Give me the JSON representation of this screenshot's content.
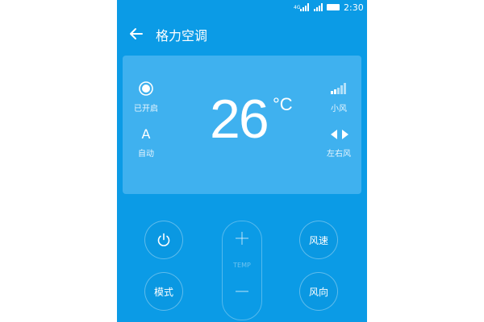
{
  "status_bar": {
    "network": "4G",
    "time": "2:30"
  },
  "header": {
    "title": "格力空调"
  },
  "card": {
    "power_status": "已开启",
    "mode_icon_text": "A",
    "mode_label": "自动",
    "fan_speed_label": "小风",
    "swing_label": "左右风",
    "temperature": "26",
    "temperature_unit": "°C"
  },
  "controls": {
    "fan_speed_button": "风速",
    "mode_button": "模式",
    "direction_button": "风向",
    "temp_label": "TEMP",
    "temp_plus": "+",
    "temp_minus": "−"
  },
  "colors": {
    "background": "#0b9be6",
    "card": "#3fb1ef"
  }
}
